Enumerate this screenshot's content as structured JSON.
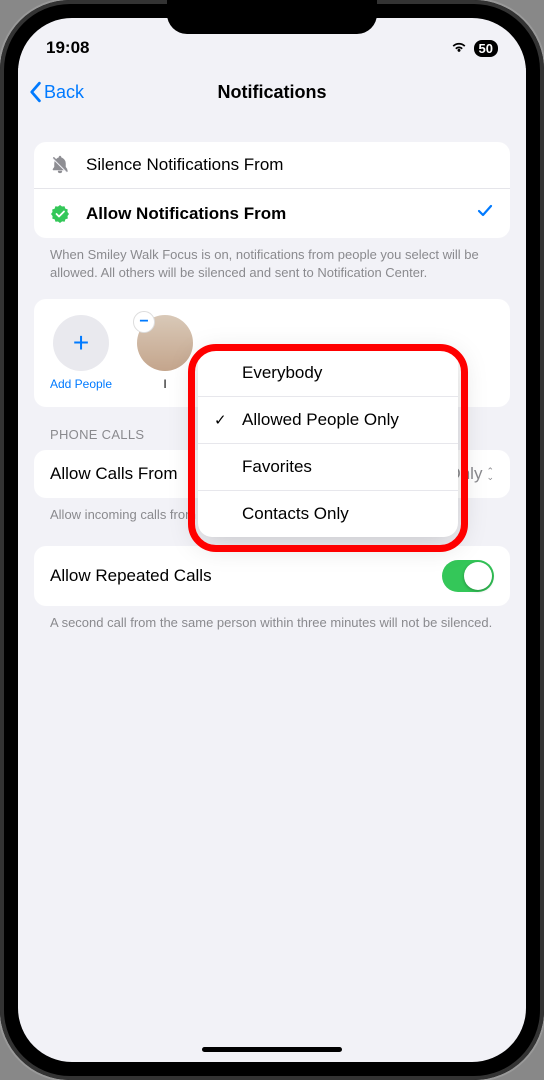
{
  "status": {
    "time": "19:08",
    "battery": "50"
  },
  "nav": {
    "back": "Back",
    "title": "Notifications"
  },
  "mode": {
    "silence": "Silence Notifications From",
    "allow": "Allow Notifications From",
    "description": "When Smiley Walk Focus is on, notifications from people you select will be allowed. All others will be silenced and sent to Notification Center."
  },
  "people": {
    "add": "Add People",
    "contact1_initial": "I"
  },
  "popup": {
    "options": [
      "Everybody",
      "Allowed People Only",
      "Favorites",
      "Contacts Only"
    ],
    "selected_index": 1
  },
  "calls": {
    "section": "PHONE CALLS",
    "allow_label": "Allow Calls From",
    "allow_value": "Allowed People Only",
    "allow_description": "Allow incoming calls from only the contacts you added to the Focus.",
    "repeated_label": "Allow Repeated Calls",
    "repeated_description": "A second call from the same person within three minutes will not be silenced."
  }
}
